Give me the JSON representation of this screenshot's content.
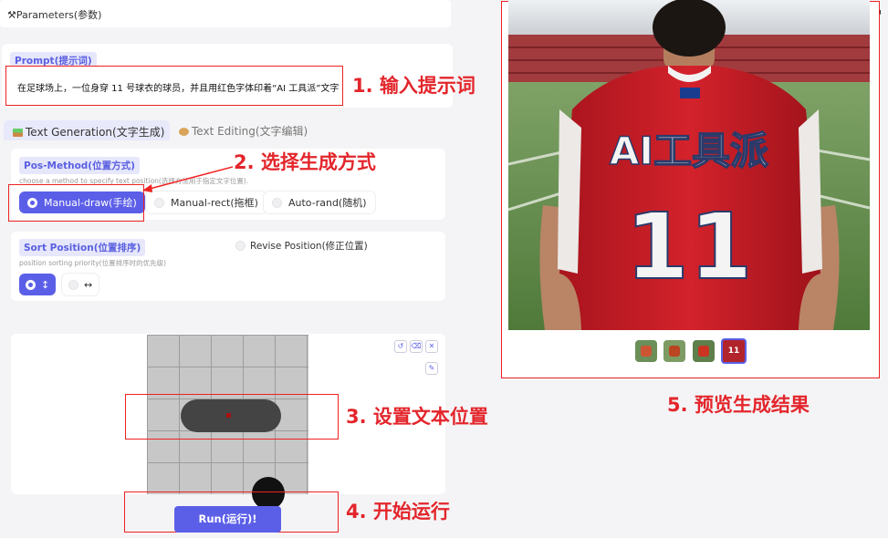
{
  "params": {
    "title": "Parameters(参数)",
    "toggle": "◄"
  },
  "prompt": {
    "label": "Prompt(提示词)",
    "value": "在足球场上，一位身穿 11 号球衣的球员，并且用红色字体印着“AI 工具派”文字"
  },
  "annotations": {
    "a1": "1. 输入提示词",
    "a2": "2. 选择生成方式",
    "a3": "3. 设置文本位置",
    "a4": "4. 开始运行",
    "a5": "5. 预览生成结果"
  },
  "tabs": [
    {
      "label": "Text Generation(文字生成)",
      "selected": true
    },
    {
      "label": "Text Editing(文字编辑)",
      "selected": false
    }
  ],
  "pos_method": {
    "label": "Pos-Method(位置方式)",
    "hint": "choose a method to specify text position(选择方法用于指定文字位置).",
    "options": [
      "Manual-draw(手绘)",
      "Manual-rect(拖框)",
      "Auto-rand(随机)"
    ],
    "selected": "Manual-draw(手绘)"
  },
  "sort": {
    "label": "Sort Position(位置排序)",
    "hint": "position sorting priority(位置排序时的优先级)",
    "revise_label": "Revise Position(修正位置)",
    "options": [
      "↕",
      "↔"
    ],
    "selected": "↕"
  },
  "canvas_tools": [
    "↺",
    "⌫",
    "✕",
    "✎"
  ],
  "run": {
    "label": "Run(运行)!"
  },
  "preview": {
    "jersey_text": "AI工具派",
    "jersey_number": "11",
    "thumbnails": 4,
    "selected_thumbnail": 4
  },
  "colors": {
    "accent": "#5b5fe8",
    "annotation": "#e3262c"
  }
}
